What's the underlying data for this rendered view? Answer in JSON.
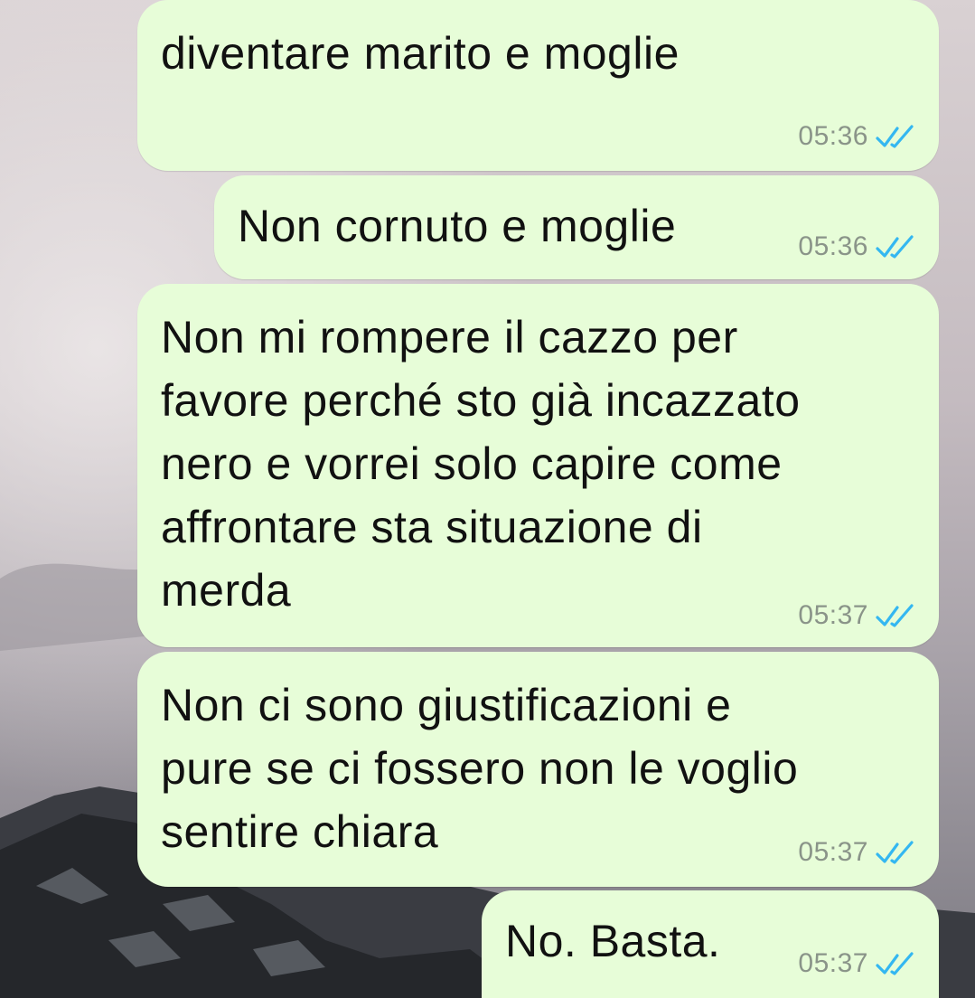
{
  "chat": {
    "messages": [
      {
        "text": "diventare marito e moglie",
        "time": "05:36",
        "status": "read"
      },
      {
        "text": "Non cornuto e moglie",
        "time": "05:36",
        "status": "read"
      },
      {
        "text": "Non mi rompere il cazzo per\nfavore perché sto già incazzato\nnero e vorrei solo capire come\naffrontare sta situazione di\nmerda",
        "time": "05:37",
        "status": "read"
      },
      {
        "text": "Non ci sono giustificazioni e\npure se ci fossero non le voglio\nsentire chiara",
        "time": "05:37",
        "status": "read"
      },
      {
        "text": "No. Basta.",
        "time": "05:37",
        "status": "read"
      }
    ]
  },
  "colors": {
    "bubble_outgoing": "#e7fdd8",
    "read_ticks": "#34b7f1",
    "timestamp": "#8a9489"
  },
  "icons": {
    "status_icon": "double-check-read-icon"
  }
}
